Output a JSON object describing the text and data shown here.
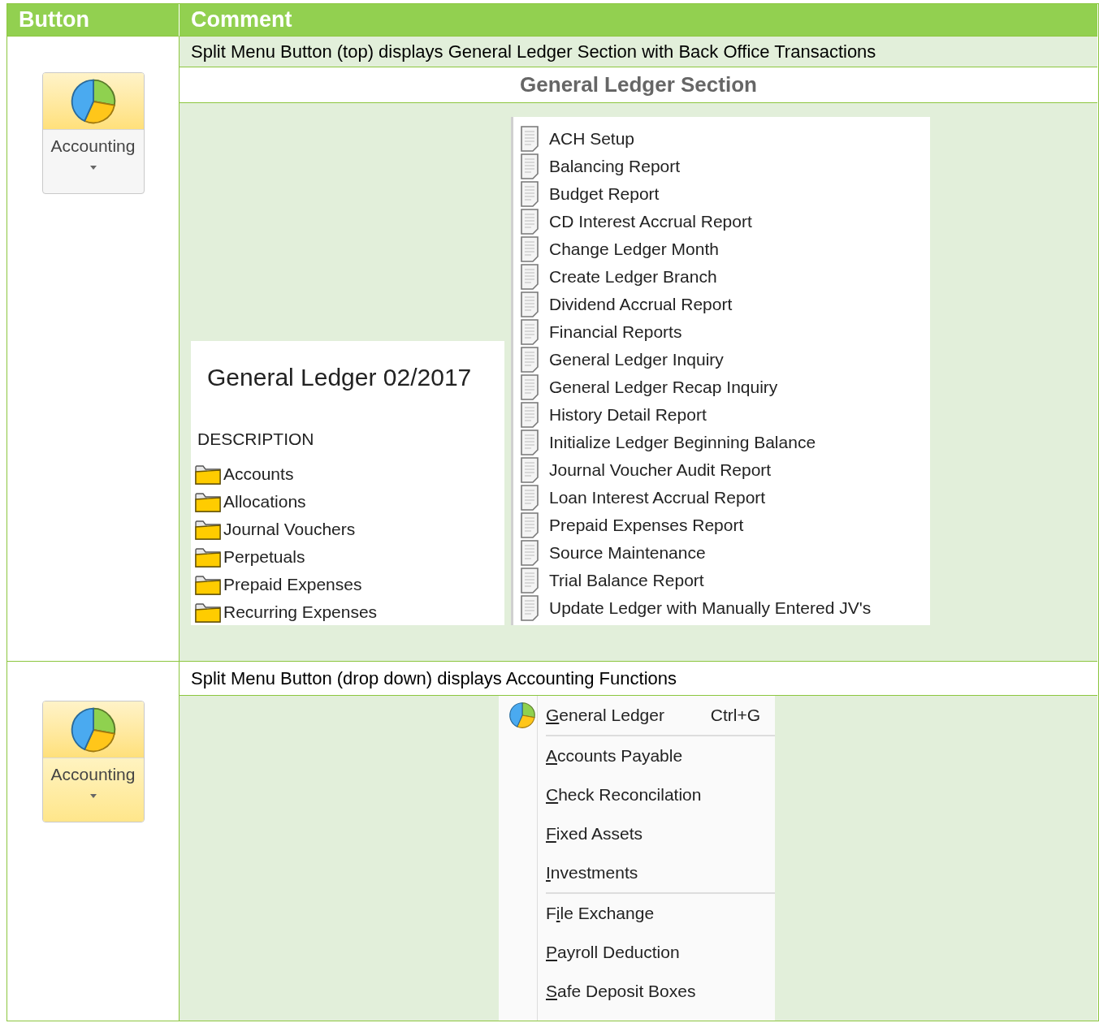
{
  "table": {
    "columns": [
      "Button",
      "Comment"
    ],
    "rows": [
      {
        "button": {
          "label": "Accounting",
          "icon_part_highlighted": true,
          "label_part_highlighted": false
        },
        "comment": "Split Menu Button (top) displays General Ledger Section with Back Office Transactions",
        "section_title": "General Ledger Section",
        "ledger_panel": {
          "title": "General Ledger 02/2017",
          "heading": "DESCRIPTION",
          "folders": [
            "Accounts",
            "Allocations",
            "Journal Vouchers",
            "Perpetuals",
            "Prepaid Expenses",
            "Recurring Expenses"
          ]
        },
        "report_list": [
          "ACH Setup",
          "Balancing Report",
          "Budget Report",
          "CD Interest Accrual Report",
          "Change Ledger Month",
          "Create Ledger Branch",
          "Dividend Accrual Report",
          "Financial Reports",
          "General Ledger Inquiry",
          "General Ledger Recap Inquiry",
          "History Detail Report",
          "Initialize Ledger Beginning Balance",
          "Journal Voucher Audit Report",
          "Loan Interest Accrual Report",
          "Prepaid Expenses Report",
          "Source Maintenance",
          "Trial Balance Report",
          "Update Ledger with Manually Entered JV's"
        ]
      },
      {
        "button": {
          "label": "Accounting",
          "icon_part_highlighted": true,
          "label_part_highlighted": true
        },
        "comment": "Split Menu Button (drop down) displays Accounting Functions",
        "menu": {
          "groups": [
            {
              "items": [
                {
                  "key": "G",
                  "after": "eneral Ledger",
                  "shortcut": "Ctrl+G",
                  "icon": true
                }
              ]
            },
            {
              "items": [
                {
                  "key": "A",
                  "after": "ccounts Payable",
                  "icon": false
                },
                {
                  "key": "C",
                  "after": "heck Reconcilation",
                  "icon": false
                },
                {
                  "key": "F",
                  "after": "ixed Assets",
                  "icon": false
                },
                {
                  "key": "I",
                  "after": "nvestments",
                  "icon": false
                }
              ]
            },
            {
              "items": [
                {
                  "before": "F",
                  "key": "i",
                  "after": "le Exchange",
                  "icon": false
                },
                {
                  "key": "P",
                  "after": "ayroll Deduction",
                  "icon": false
                },
                {
                  "key": "S",
                  "after": "afe Deposit Boxes",
                  "icon": false
                }
              ]
            }
          ]
        }
      }
    ]
  }
}
